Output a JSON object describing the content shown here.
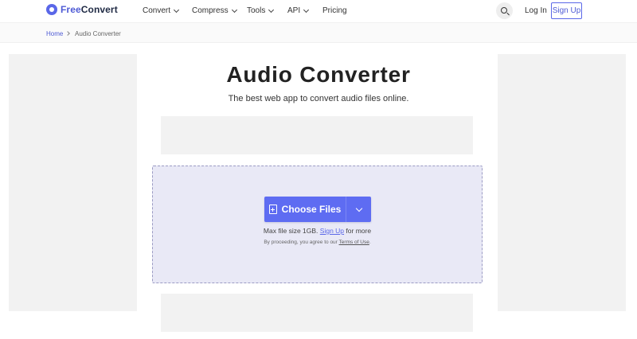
{
  "header": {
    "logo_free": "Free",
    "logo_convert": "Convert",
    "nav": [
      {
        "label": "Convert",
        "has_dropdown": true
      },
      {
        "label": "Compress",
        "has_dropdown": true
      },
      {
        "label": "Tools",
        "has_dropdown": true
      },
      {
        "label": "API",
        "has_dropdown": true
      },
      {
        "label": "Pricing",
        "has_dropdown": false
      }
    ],
    "login_label": "Log In",
    "signup_label": "Sign Up"
  },
  "breadcrumb": {
    "home": "Home",
    "current": "Audio Converter"
  },
  "main": {
    "title": "Audio Converter",
    "subtitle": "The best web app to convert audio files online.",
    "choose_files_label": "Choose Files",
    "max_size_prefix": "Max file size 1GB.",
    "max_size_link": "Sign Up",
    "max_size_suffix": "for more",
    "terms_prefix": "By proceeding, you agree to our",
    "terms_link": "Terms of Use",
    "terms_suffix": "."
  },
  "colors": {
    "accent": "#5e6cf2",
    "dropzone_bg": "#e9e9f6",
    "ad_placeholder": "#f2f2f2"
  },
  "icons": {
    "logo": "freeconvert-logo-icon",
    "search": "search-icon",
    "file": "file-add-icon",
    "dropdown": "chevron-down-icon",
    "breadcrumb_separator": "chevron-right-icon"
  }
}
